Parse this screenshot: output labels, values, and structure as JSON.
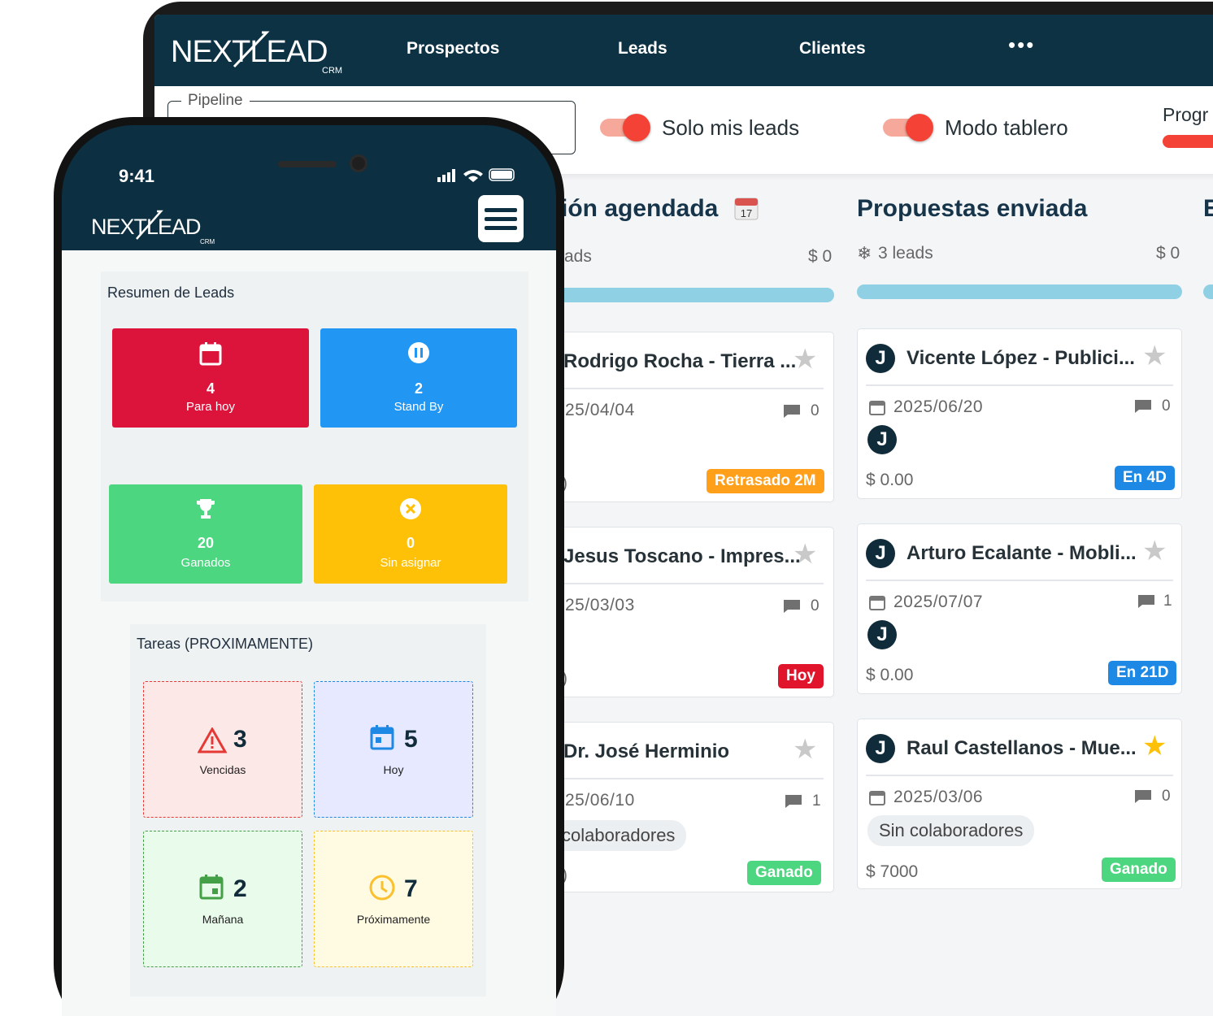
{
  "app": {
    "logo_text": "NEXTLEAD",
    "logo_sub": "CRM"
  },
  "desktop": {
    "nav": {
      "prospectos": "Prospectos",
      "leads": "Leads",
      "clientes": "Clientes",
      "more": "•••"
    },
    "filters": {
      "pipeline_label": "Pipeline",
      "solo_mis_leads": "Solo mis leads",
      "modo_tablero": "Modo tablero",
      "progress_label": "Progr"
    },
    "columns": [
      {
        "title": "ión agendada",
        "calendar_day": "17",
        "meta": "ads",
        "amount": "$ 0",
        "cards": [
          {
            "title": "Rodrigo Rocha - Tierra ...",
            "date": "25/04/04",
            "comments": "0",
            "amount": ")",
            "badge": "Retrasado 2M"
          },
          {
            "title": "Jesus Toscano - Impres...",
            "date": "25/03/03",
            "comments": "0",
            "amount": ")",
            "badge": "Hoy"
          },
          {
            "title": "Dr. José Herminio",
            "date": "25/06/10",
            "comments": "1",
            "chip": "colaboradores",
            "amount": ")",
            "badge": "Ganado"
          }
        ]
      },
      {
        "title": "Propuestas enviada",
        "meta": "3 leads",
        "amount": "$ 0",
        "cards": [
          {
            "title": "Vicente López - Publici...",
            "date": "2025/06/20",
            "comments": "0",
            "amount": "$ 0.00",
            "badge": "En 4D",
            "avatar": "J"
          },
          {
            "title": "Arturo Ecalante - Mobli...",
            "date": "2025/07/07",
            "comments": "1",
            "amount": "$ 0.00",
            "badge": "En 21D",
            "avatar": "J"
          },
          {
            "title": "Raul Castellanos - Mue...",
            "date": "2025/03/06",
            "comments": "0",
            "chip": "Sin colaboradores",
            "amount": "$ 7000",
            "badge": "Ganado",
            "avatar": "J"
          }
        ]
      },
      {
        "title": "E"
      }
    ]
  },
  "phone": {
    "status_time": "9:41",
    "resumen": {
      "title": "Resumen de Leads",
      "tiles": [
        {
          "num": "4",
          "label": "Para hoy"
        },
        {
          "num": "2",
          "label": "Stand By"
        },
        {
          "num": "20",
          "label": "Ganados"
        },
        {
          "num": "0",
          "label": "Sin asignar"
        }
      ]
    },
    "tareas": {
      "title": "Tareas (PROXIMAMENTE)",
      "items": [
        {
          "num": "3",
          "label": "Vencidas"
        },
        {
          "num": "5",
          "label": "Hoy"
        },
        {
          "num": "2",
          "label": "Mañana"
        },
        {
          "num": "7",
          "label": "Próximamente"
        }
      ]
    }
  },
  "colors": {
    "navy": "#0d3244",
    "red_tile": "#dc143c",
    "blue_tile": "#2196f3",
    "green_tile": "#4cd680",
    "yellow_tile": "#ffc107",
    "badge_orange": "#ff9f1a",
    "badge_red": "#e0152c",
    "badge_green": "#4cd680",
    "badge_blue": "#1e88e5",
    "star_gold": "#ffc107"
  }
}
